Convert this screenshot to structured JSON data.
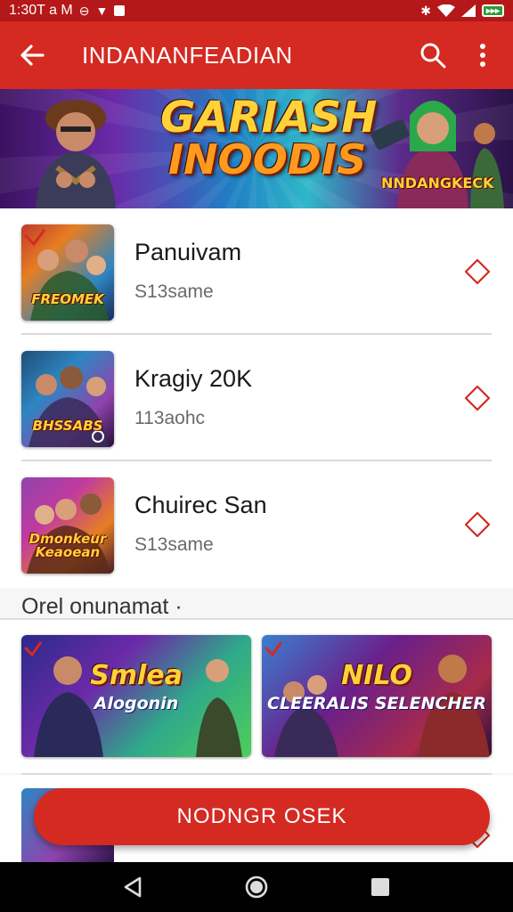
{
  "status_bar": {
    "time": "1:30T a M",
    "battery_text": "▸▸▸"
  },
  "app_bar": {
    "title": "INDANANFEADIAN",
    "back_icon": "arrow-left-icon",
    "search_icon": "search-icon",
    "menu_icon": "more-vertical-icon"
  },
  "banner": {
    "title_line1": "GARIASH",
    "title_line2": "INOODIS",
    "tag": "NNDANGKECK"
  },
  "list": [
    {
      "title": "Panuivam",
      "subtitle": "S13same",
      "thumb_caption": "FREOMEK",
      "thumb_colors": [
        "#c0392b",
        "#2e86c1"
      ]
    },
    {
      "title": "Kragiy 20K",
      "subtitle": "113aohc",
      "thumb_caption": "BHSSABS",
      "thumb_colors": [
        "#1f4e79",
        "#8e44ad"
      ]
    },
    {
      "title": "Chuirec San",
      "subtitle": "S13same",
      "thumb_caption": "Dmonkeur Keaoean",
      "thumb_colors": [
        "#8e44ad",
        "#e67e22"
      ]
    }
  ],
  "section": {
    "title": "Orel onunamat ·"
  },
  "cards": [
    {
      "title": "Smlea",
      "subtitle": "Alogonin",
      "colors": [
        "#2a2a8a",
        "#4ecf5a"
      ]
    },
    {
      "title": "NILO",
      "subtitle": "CLEERALIS SELENCHER",
      "colors": [
        "#6b1f8a",
        "#3a7fd0"
      ]
    }
  ],
  "cta": {
    "label": "NODNGR OSEK"
  },
  "colors": {
    "primary": "#d42a22",
    "status": "#b51818",
    "accent": "#ffd23a"
  }
}
